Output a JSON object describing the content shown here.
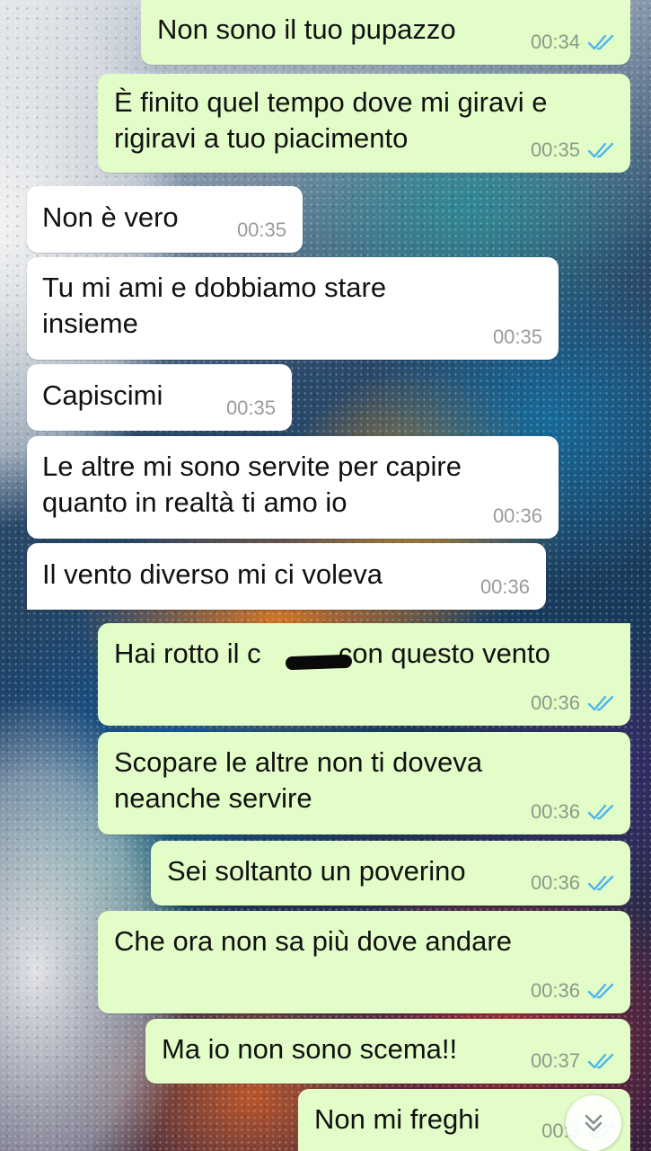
{
  "chat": {
    "messages": [
      {
        "direction": "out",
        "text": "Non sono il tuo pupazzo",
        "time": "00:34",
        "status": "read"
      },
      {
        "direction": "out",
        "text": "È finito quel tempo dove mi giravi e\nrigiravi a tuo piacimento",
        "time": "00:35",
        "status": "read"
      },
      {
        "direction": "in",
        "text": "Non è vero",
        "time": "00:35"
      },
      {
        "direction": "in",
        "text": "Tu mi ami e dobbiamo stare\ninsieme",
        "time": "00:35"
      },
      {
        "direction": "in",
        "text": "Capiscimi",
        "time": "00:35"
      },
      {
        "direction": "in",
        "text": "Le altre mi sono servite per capire\nquanto in realtà ti amo io",
        "time": "00:36"
      },
      {
        "direction": "in",
        "text": "Il vento diverso mi ci voleva",
        "time": "00:36"
      },
      {
        "direction": "out",
        "text": "Hai rotto il c          con questo vento",
        "time": "00:36",
        "status": "read",
        "redacted": true
      },
      {
        "direction": "out",
        "text": "Scopare le altre non ti doveva\nneanche servire",
        "time": "00:36",
        "status": "read"
      },
      {
        "direction": "out",
        "text": "Sei soltanto un poverino",
        "time": "00:36",
        "status": "read"
      },
      {
        "direction": "out",
        "text": "Che ora non sa più dove andare",
        "time": "00:36",
        "status": "read"
      },
      {
        "direction": "out",
        "text": "Ma io non sono scema!!",
        "time": "00:37",
        "status": "read"
      },
      {
        "direction": "out",
        "text": "Non mi freghi",
        "time": "00:3",
        "status": "read"
      }
    ]
  },
  "colors": {
    "outgoing_bubble": "#e2fdc8",
    "incoming_bubble": "#ffffff",
    "read_ticks": "#4fb6ec"
  },
  "icons": {
    "read_ticks": "double-check-icon",
    "scroll_down": "chevron-double-down-icon"
  }
}
